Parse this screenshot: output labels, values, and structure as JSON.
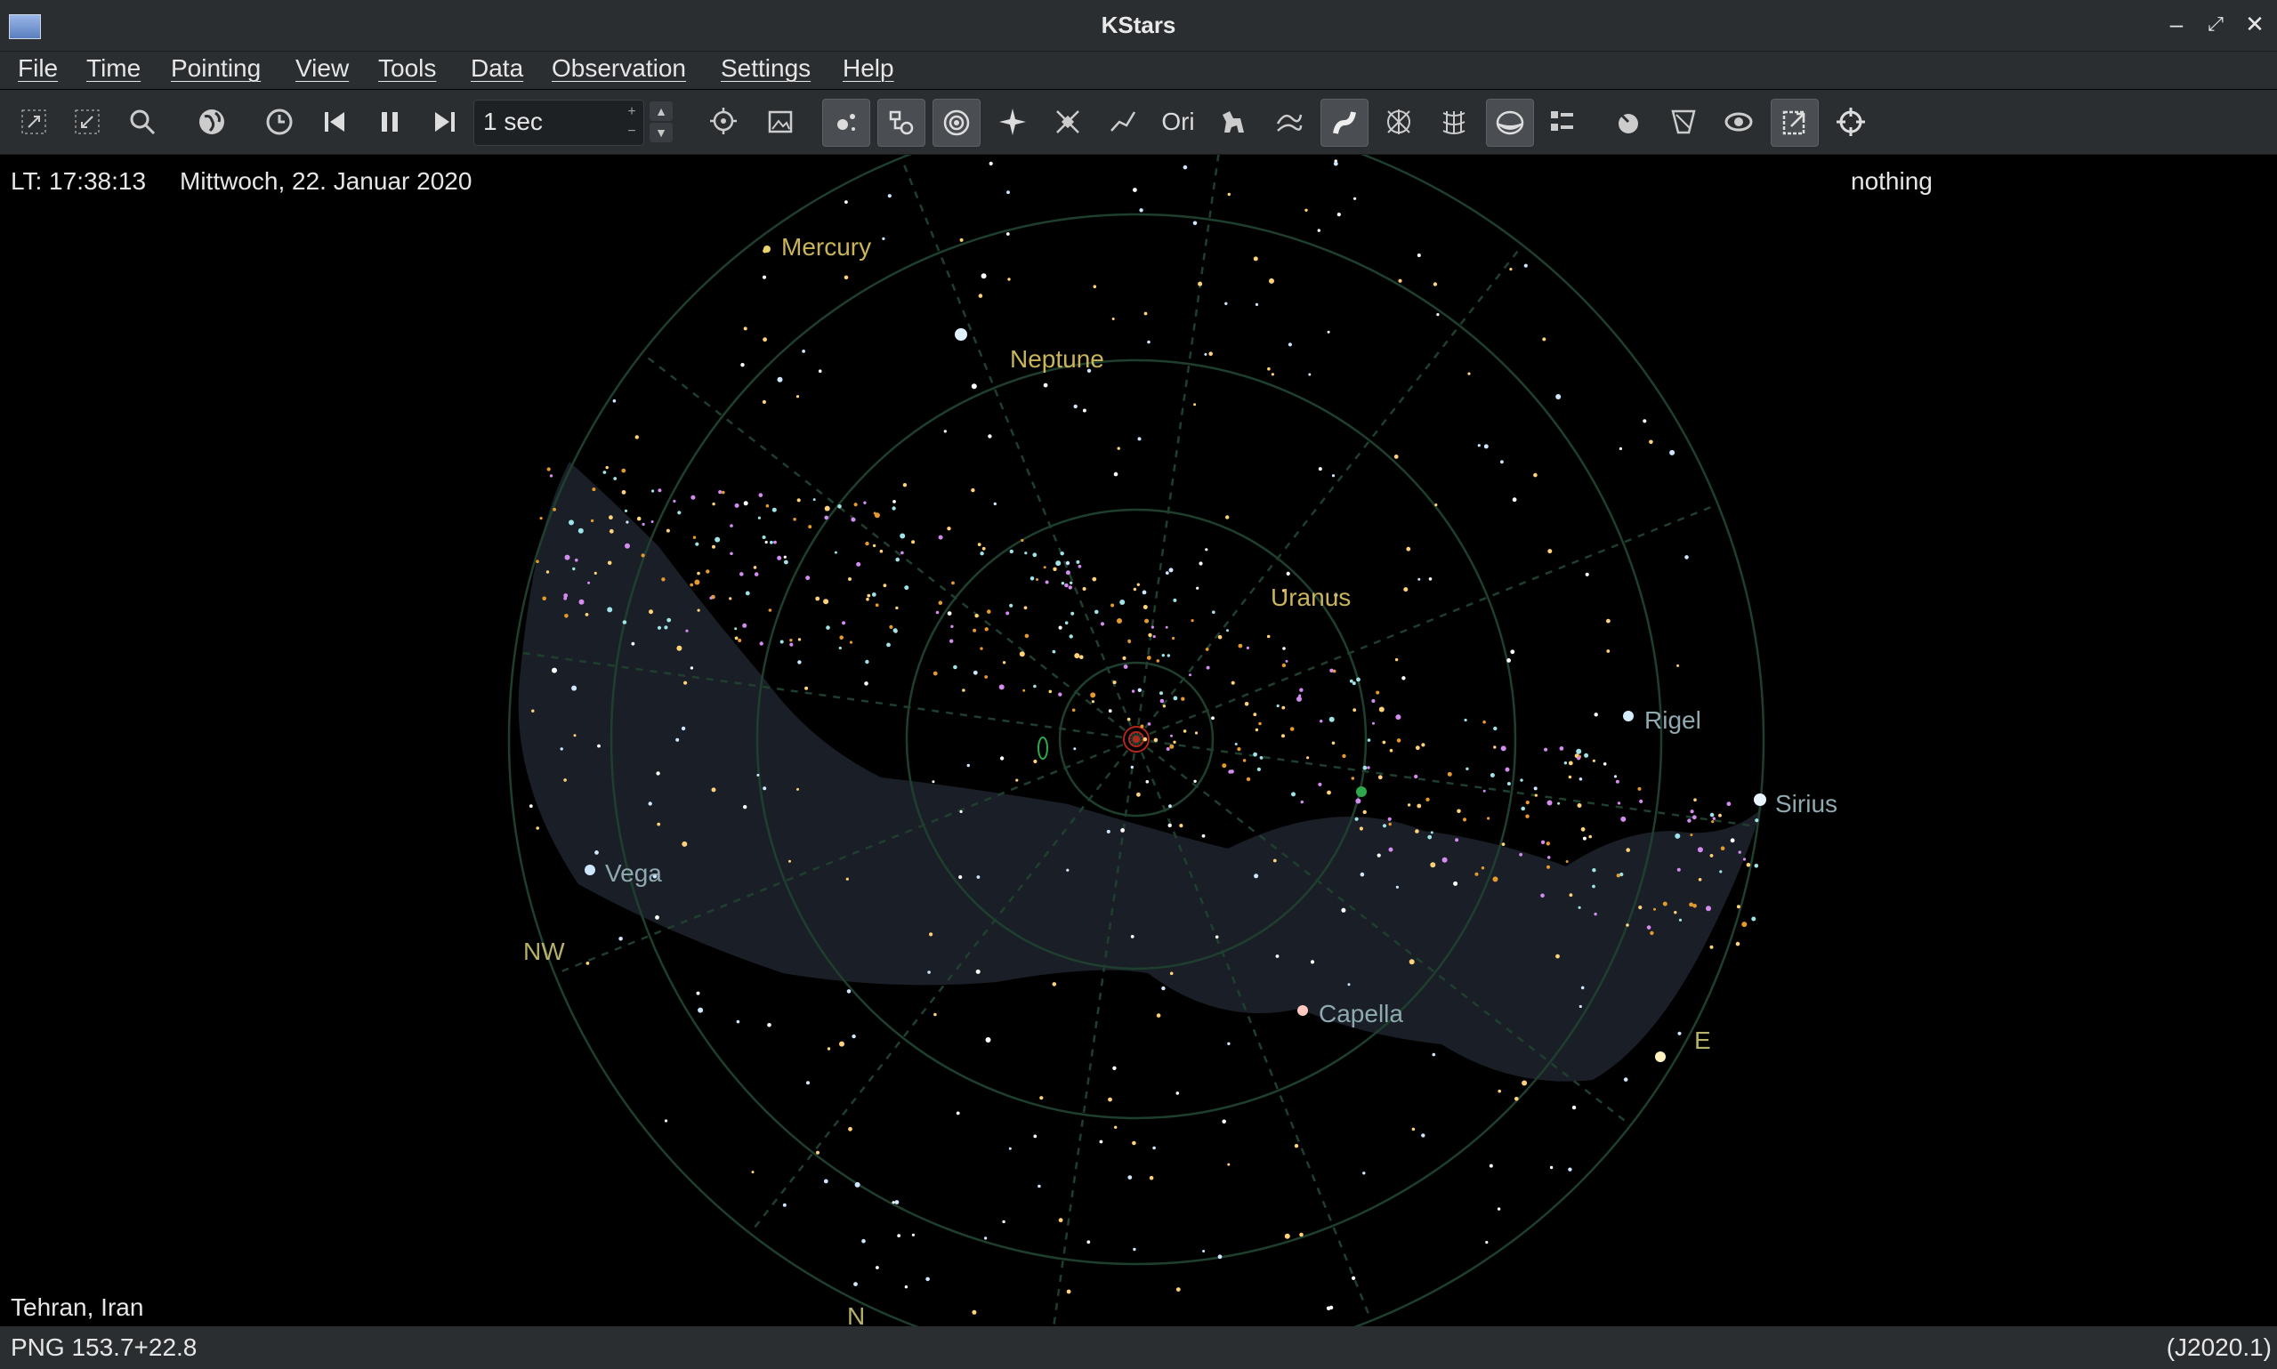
{
  "window": {
    "title": "KStars"
  },
  "menu": [
    {
      "label": "File"
    },
    {
      "label": "Time"
    },
    {
      "label": "Pointing"
    },
    {
      "label": "View"
    },
    {
      "label": "Tools"
    },
    {
      "label": "Data"
    },
    {
      "label": "Observation"
    },
    {
      "label": "Settings"
    },
    {
      "label": "Help"
    }
  ],
  "toolbar": {
    "time_step": "1 sec"
  },
  "sky": {
    "local_time": "LT: 17:38:13",
    "date": "Mittwoch, 22. Januar 2020",
    "focus_object": "nothing",
    "location": "Tehran, Iran",
    "planets": {
      "mercury": "Mercury",
      "neptune": "Neptune",
      "uranus": "Uranus"
    },
    "stars": {
      "vega": "Vega",
      "rigel": "Rigel",
      "sirius": "Sirius",
      "capella": "Capella"
    },
    "compass": {
      "nw": "NW",
      "e": "E",
      "n": "N"
    },
    "colors": {
      "planet": "#c9b45a",
      "star_label": "#8fa9b0",
      "compass": "#b7b06a",
      "grid": "#1f3a2c",
      "milky_way": "#1a1e25"
    }
  },
  "status": {
    "coords": "PNG 153.7+22.8",
    "epoch": "(J2020.1)"
  }
}
